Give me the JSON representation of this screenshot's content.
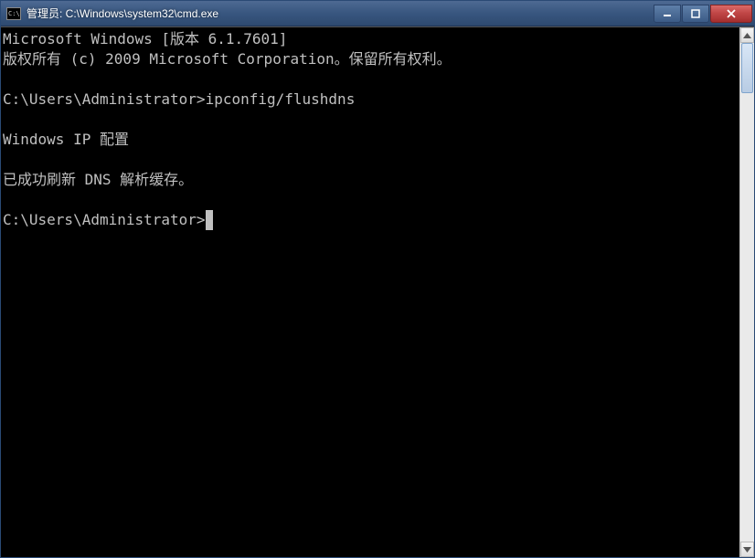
{
  "titlebar": {
    "icon_glyph": "C:\\",
    "title": "管理员: C:\\Windows\\system32\\cmd.exe"
  },
  "terminal": {
    "line_version": "Microsoft Windows [版本 6.1.7601]",
    "line_copyright": "版权所有 (c) 2009 Microsoft Corporation。保留所有权利。",
    "blank1": "",
    "prompt1_path": "C:\\Users\\Administrator>",
    "prompt1_cmd": "ipconfig/flushdns",
    "blank2": "",
    "output_header": "Windows IP 配置",
    "blank3": "",
    "output_result": "已成功刷新 DNS 解析缓存。",
    "blank4": "",
    "prompt2_path": "C:\\Users\\Administrator>"
  }
}
